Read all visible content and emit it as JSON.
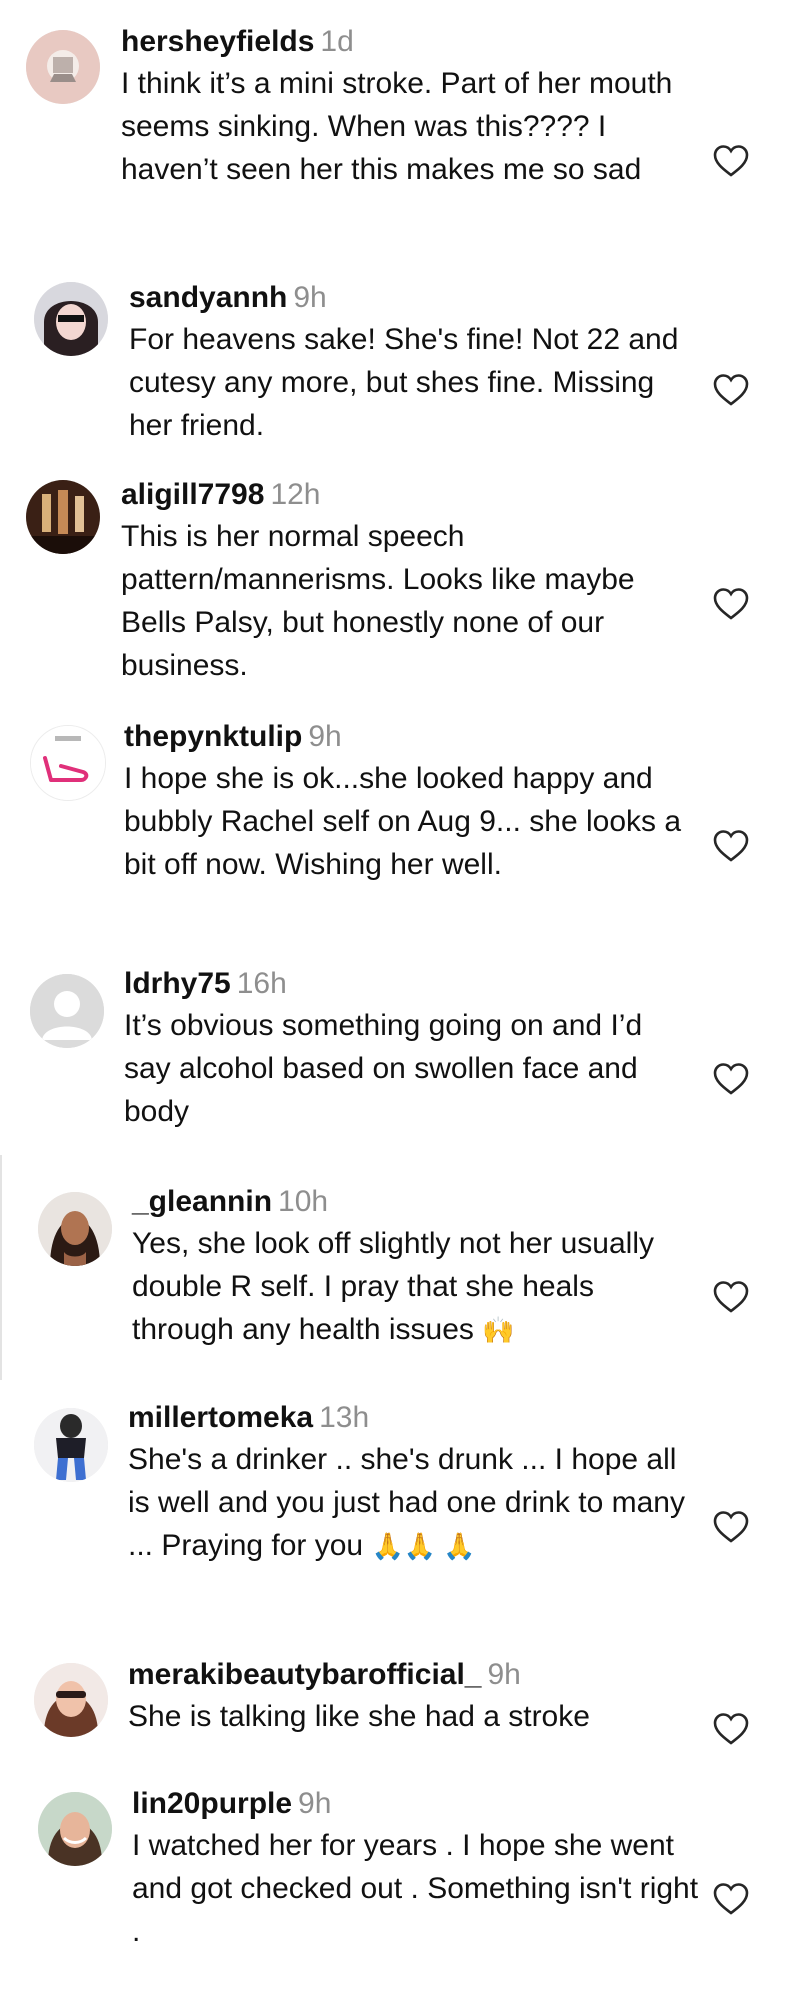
{
  "comments": [
    {
      "username": "hersheyfields",
      "time": "1d",
      "text": "I think it’s a mini stroke. Part of her mouth seems sinking. When was this???? I haven’t seen her this makes me so sad",
      "avatar_icon": "avatar-image"
    },
    {
      "username": "sandyannh",
      "time": "9h",
      "text": "For heavens sake! She's fine! Not 22 and cutesy any more, but shes fine. Missing her friend.",
      "avatar_icon": "avatar-image"
    },
    {
      "username": "aligill7798",
      "time": "12h",
      "text": "This is her normal speech pattern/mannerisms. Looks like maybe Bells Palsy, but honestly none of our business.",
      "avatar_icon": "avatar-image"
    },
    {
      "username": "thepynktulip",
      "time": "9h",
      "text": "I hope she is ok...she looked happy and bubbly Rachel self on Aug 9... she looks a bit off now. Wishing her well.",
      "avatar_icon": "avatar-image"
    },
    {
      "username": "ldrhy75",
      "time": "16h",
      "text": "It’s obvious something going on and I’d say alcohol based on swollen face and body",
      "avatar_icon": "default-avatar-icon"
    },
    {
      "username": "_gleannin",
      "time": "10h",
      "text": "Yes, she look off slightly not her usually double R self. I pray that she heals through any health issues",
      "emoji": "🙌",
      "avatar_icon": "avatar-image"
    },
    {
      "username": "millertomeka",
      "time": "13h",
      "text": "She's a drinker .. she's drunk ... I hope all is well and you just had one drink to many ... Praying for you",
      "emoji": "🙏🙏 🙏",
      "avatar_icon": "avatar-image"
    },
    {
      "username": "merakibeautybarofficial_",
      "time": "9h",
      "text": "She is talking like she had a stroke",
      "avatar_icon": "avatar-image"
    },
    {
      "username": "lin20purple",
      "time": "9h",
      "text": "I watched her for years . I hope she went and got checked out . Something isn't right .",
      "avatar_icon": "avatar-image"
    }
  ],
  "like_icon": "heart-outline-icon",
  "colors": {
    "text": "#111111",
    "secondary": "#8e8e8e",
    "background": "#ffffff"
  }
}
